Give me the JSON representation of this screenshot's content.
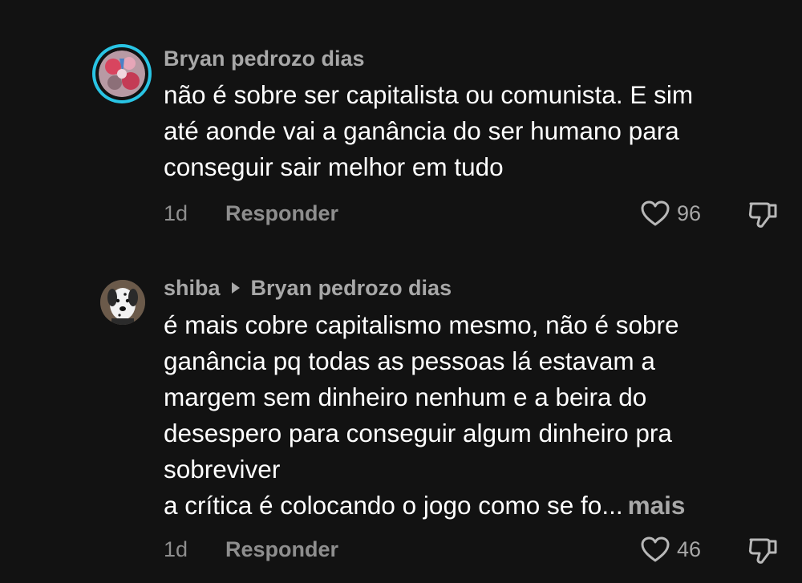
{
  "comments": [
    {
      "author": "Bryan pedrozo dias",
      "lines": [
        "não é sobre ser capitalista ou comunista. E sim",
        "até aonde vai a ganância do ser humano para",
        "conseguir sair melhor em tudo"
      ],
      "time": "1d",
      "reply_label": "Responder",
      "likes": "96",
      "avatar_icon": "profile-photo-with-story-ring"
    },
    {
      "author": "shiba",
      "reply_to": "Bryan pedrozo dias",
      "lines": [
        "é mais cobre capitalismo mesmo, não é sobre",
        "ganância pq todas as pessoas lá estavam a",
        "margem sem dinheiro nenhum e a beira do",
        "desespero para conseguir algum dinheiro pra",
        "sobreviver",
        "a crítica é colocando o jogo como se fo..."
      ],
      "more_label": "mais",
      "time": "1d",
      "reply_label": "Responder",
      "likes": "46",
      "avatar_icon": "dog-profile-photo"
    }
  ],
  "icons": {
    "like": "heart-outline-icon",
    "dislike": "thumbs-down-icon"
  },
  "colors": {
    "background": "#121212",
    "text": "#ffffff",
    "muted": "#a8a8a8",
    "story_ring": "#29c4e4"
  }
}
